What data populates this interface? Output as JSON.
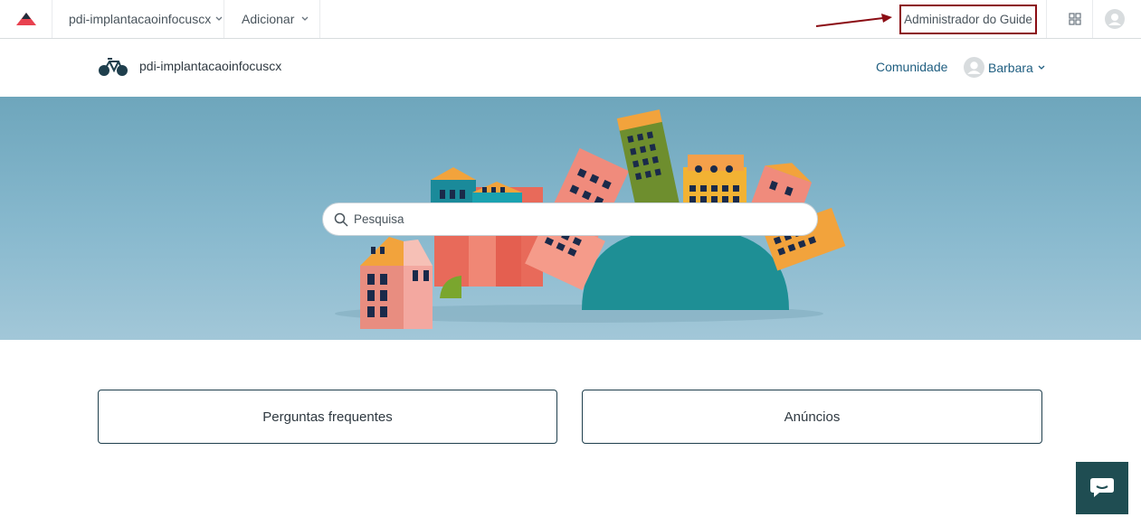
{
  "topbar": {
    "brand": "pdi-implantacaoinfocuscx",
    "add_label": "Adicionar",
    "admin_label": "Administrador do Guide",
    "logo_icon": "zendesk-triangle-icon",
    "accent": "#e8414f",
    "highlight_color": "#8b0d14"
  },
  "header": {
    "site_name": "pdi-implantacaoinfocuscx",
    "community_label": "Comunidade",
    "user_name": "Barbara",
    "logo_icon": "bicycle-icon"
  },
  "hero": {
    "search_placeholder": "Pesquisa"
  },
  "blocks": [
    {
      "label": "Perguntas frequentes"
    },
    {
      "label": "Anúncios"
    }
  ],
  "chat": {
    "icon": "chat-bubble-icon",
    "color": "#1f4d52"
  }
}
